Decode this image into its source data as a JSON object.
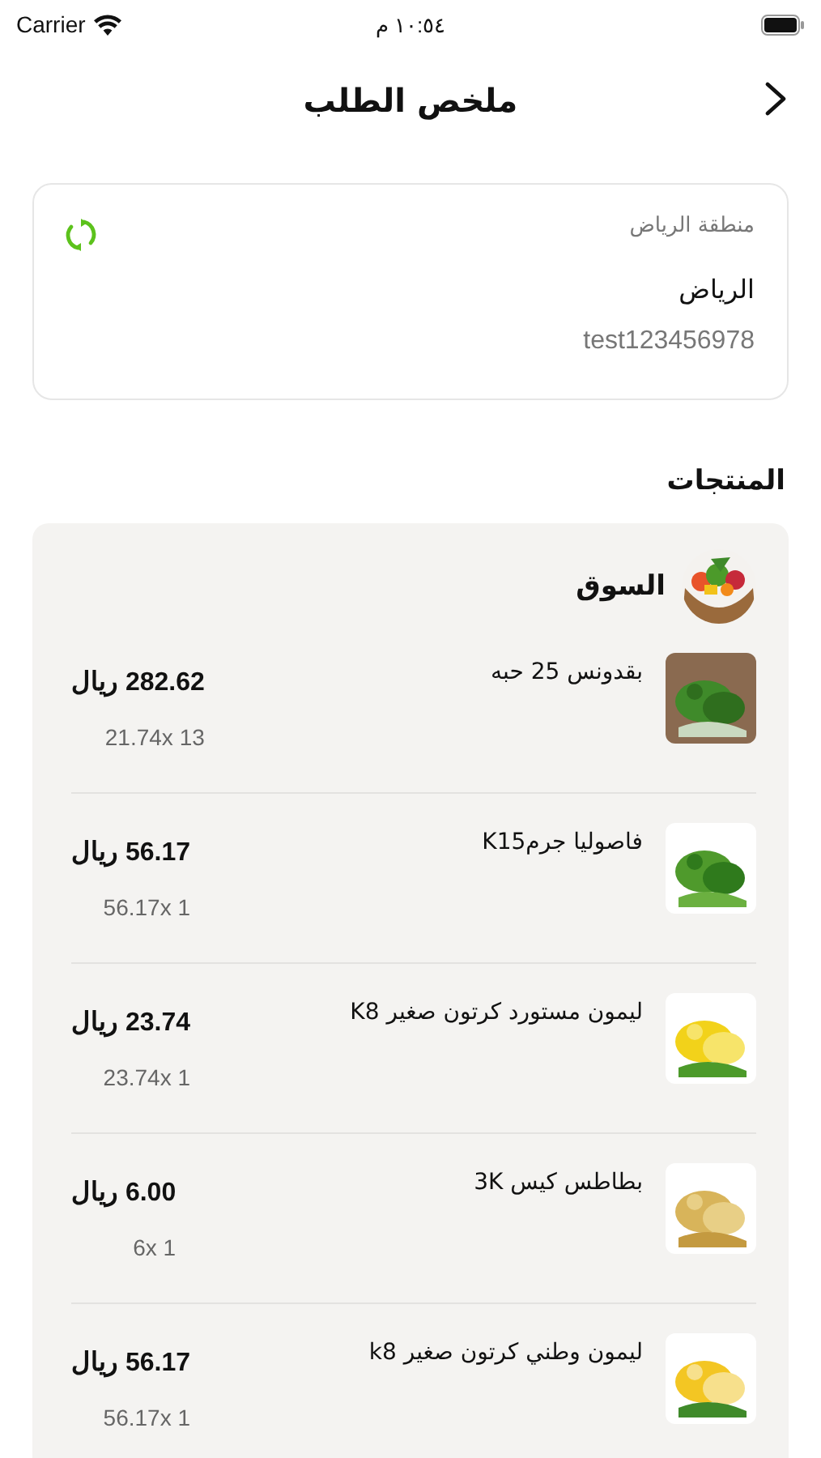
{
  "status_bar": {
    "carrier": "Carrier",
    "time": "١٠:٥٤ م"
  },
  "header": {
    "title": "ملخص الطلب"
  },
  "address": {
    "region": "منطقة الرياض",
    "city": "الرياض",
    "note": "test123456978"
  },
  "products_heading": "المنتجات",
  "store": {
    "name": "السوق",
    "items": [
      {
        "name": "بقدونس 25 حبه",
        "total": "282.62 ريال",
        "quantity": "21.74x 13"
      },
      {
        "name": "فاصوليا جرمK15",
        "total": "56.17 ريال",
        "quantity": "56.17x 1"
      },
      {
        "name": "ليمون مستورد كرتون صغير K8",
        "total": "23.74 ريال",
        "quantity": "23.74x 1"
      },
      {
        "name": "بطاطس كيس 3K",
        "total": "6.00 ريال",
        "quantity": "6x 1"
      },
      {
        "name": "ليمون وطني كرتون صغير k8",
        "total": "56.17 ريال",
        "quantity": "56.17x 1"
      }
    ]
  }
}
